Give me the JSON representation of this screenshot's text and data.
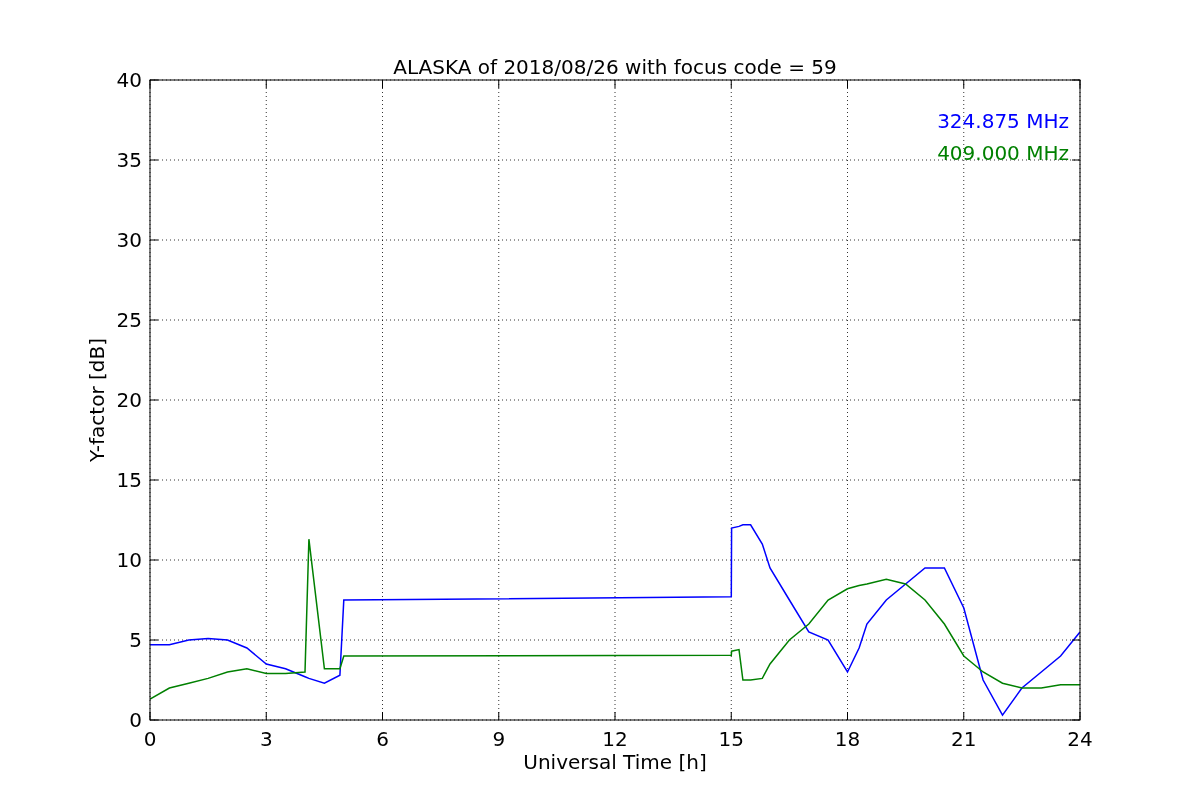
{
  "figure": {
    "chart_data": {
      "type": "line",
      "title": "ALASKA of 2018/08/26 with focus code = 59",
      "xlabel": "Universal Time [h]",
      "ylabel": "Y-factor [dB]",
      "x": [
        0,
        0.5,
        1,
        1.5,
        2,
        2.5,
        3,
        3.5,
        4,
        4.1,
        4.5,
        4.9,
        5,
        15,
        15.01,
        15.2,
        15.3,
        15.5,
        15.8,
        16,
        16.5,
        17,
        17.5,
        18,
        18.3,
        18.5,
        19,
        19.5,
        20,
        20.5,
        21,
        21.5,
        22,
        22.5,
        23,
        23.5,
        24
      ],
      "series": [
        {
          "name": "324.875 MHz",
          "color": "#0000ff",
          "values": [
            4.7,
            4.7,
            5.0,
            5.1,
            5.0,
            4.5,
            3.5,
            3.2,
            2.7,
            2.6,
            2.3,
            2.8,
            7.5,
            7.7,
            12,
            12.1,
            12.2,
            12.2,
            11,
            9.5,
            7.5,
            5.5,
            5,
            3,
            4.5,
            6,
            7.5,
            8.5,
            9.5,
            9.5,
            7,
            2.5,
            0.3,
            2,
            3,
            4,
            5.5
          ]
        },
        {
          "name": "409.000 MHz",
          "color": "#008000",
          "values": [
            1.3,
            2,
            2.3,
            2.6,
            3,
            3.2,
            2.9,
            2.9,
            3.0,
            11.3,
            3.2,
            3.2,
            4.0,
            4.05,
            4.3,
            4.4,
            2.5,
            2.5,
            2.6,
            3.5,
            5,
            6,
            7.5,
            8.2,
            8.4,
            8.5,
            8.8,
            8.5,
            7.5,
            6,
            4,
            3,
            2.3,
            2,
            2,
            2.2,
            2.2
          ]
        }
      ],
      "xlim": [
        0,
        24
      ],
      "ylim": [
        0,
        40
      ],
      "xticks": [
        0,
        3,
        6,
        9,
        12,
        15,
        18,
        21,
        24
      ],
      "yticks": [
        0,
        5,
        10,
        15,
        20,
        25,
        30,
        35,
        40
      ],
      "grid": true
    }
  }
}
